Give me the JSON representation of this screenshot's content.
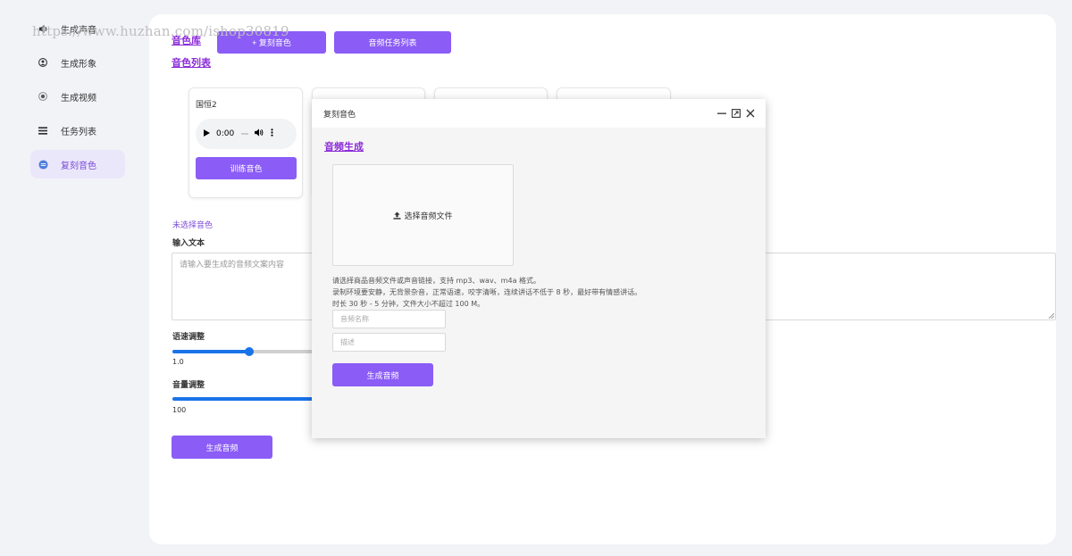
{
  "watermark": "https://www.huzhan.com/ishop30819",
  "sidebar": {
    "items": [
      {
        "label": "生成声音",
        "icon": "speaker-icon"
      },
      {
        "label": "生成形象",
        "icon": "user-icon"
      },
      {
        "label": "生成视频",
        "icon": "video-icon"
      },
      {
        "label": "任务列表",
        "icon": "list-icon"
      },
      {
        "label": "复刻音色",
        "icon": "clone-voice-icon",
        "active": true
      }
    ]
  },
  "main": {
    "voice_library_title": "音色库",
    "clone_voice_button": "+ 复刻音色",
    "audio_task_list_button": "音频任务列表",
    "voice_list_title": "音色列表",
    "voice_card": {
      "name": "国恒2",
      "audio_time": "0:00",
      "train_button": "训练音色"
    },
    "no_voice_selected": "未选择音色",
    "input_text_label": "输入文本",
    "input_text_placeholder": "请输入要生成的音频文案内容",
    "speed_label": "语速调整",
    "speed_value": "1.0",
    "speed_fraction": 0.41,
    "volume_label": "音量调整",
    "volume_value": "100",
    "generate_button": "生成音频"
  },
  "modal": {
    "title": "复刻音色",
    "section_title": "音频生成",
    "upload_label": "选择音频文件",
    "hints": [
      "请选择商品音频文件或声音链接，支持 mp3、wav、m4a 格式。",
      "录制环境要安静，无背景杂音，正常语速，咬字清晰，连续讲话不低于 8 秒，最好带有情感讲话。",
      "时长 30 秒 - 5 分钟，文件大小不超过 100 M。"
    ],
    "name_placeholder": "音频名称",
    "desc_placeholder": "描述",
    "generate_button": "生成音频"
  },
  "colors": {
    "accent": "#8b5cf6",
    "title_purple": "#8b2bd8",
    "slider_blue": "#1a73e8"
  }
}
